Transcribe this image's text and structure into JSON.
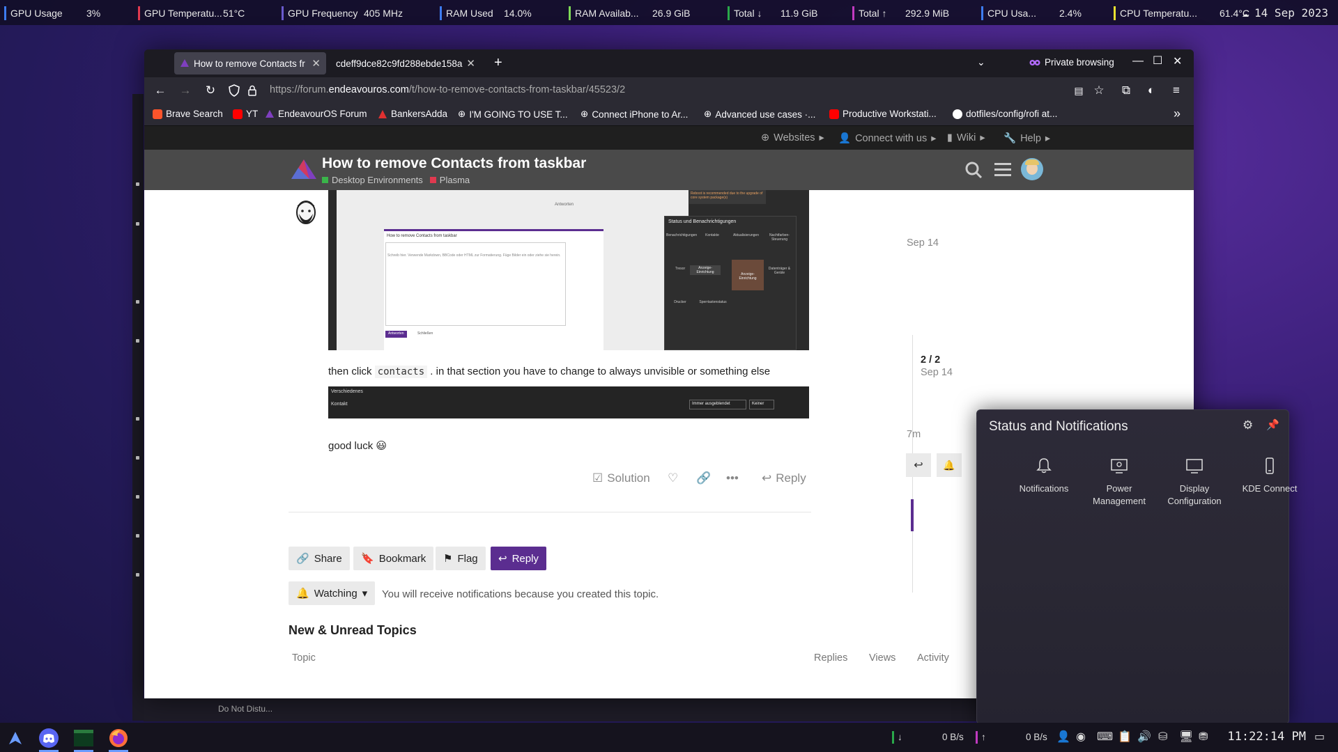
{
  "sysbar": {
    "sensors": [
      {
        "label": "GPU Usage",
        "value": "3%",
        "color": "#3d7cf0"
      },
      {
        "label": "GPU Temperatu...",
        "value": "51°C",
        "color": "#e0394f"
      },
      {
        "label": "GPU Frequency",
        "value": "405 MHz",
        "color": "#6a5acd"
      },
      {
        "label": "RAM Used",
        "value": "14.0%",
        "color": "#3d7cf0"
      },
      {
        "label": "RAM Availab...",
        "value": "26.9 GiB",
        "color": "#7ed957"
      },
      {
        "label": "Total ↓",
        "value": "11.9 GiB",
        "color": "#2aa84a"
      },
      {
        "label": "Total ↑",
        "value": "292.9 MiB",
        "color": "#c03ac0"
      },
      {
        "label": "CPU Usa...",
        "value": "2.4%",
        "color": "#3d7cf0"
      },
      {
        "label": "CPU Temperatu...",
        "value": "61.4°C",
        "color": "#e8e030"
      }
    ],
    "date": "14 Sep 2023"
  },
  "browser": {
    "tabs": [
      {
        "title": "How to remove Contacts fr",
        "active": true
      },
      {
        "title": "cdeff9dce82c9fd288ebde158a",
        "active": false
      }
    ],
    "new_tab": "+",
    "private_label": "Private browsing",
    "url_prefix": "https://forum.",
    "url_domain": "endeavouros.com",
    "url_path": "/t/how-to-remove-contacts-from-taskbar/45523/2",
    "bookmarks": [
      {
        "label": "Brave Search",
        "color": "#fb542b"
      },
      {
        "label": "YT",
        "color": "#ff0000"
      },
      {
        "label": "EndeavourOS Forum",
        "color": "#7f3fbf"
      },
      {
        "label": "BankersAdda",
        "color": "#e03030"
      },
      {
        "label": "I'M GOING TO USE T...",
        "color": "#cccccc"
      },
      {
        "label": "Connect iPhone to Ar...",
        "color": "#cccccc"
      },
      {
        "label": "Advanced use cases ·...",
        "color": "#cccccc"
      },
      {
        "label": "Productive Workstati...",
        "color": "#ff0000"
      },
      {
        "label": "dotfiles/config/rofi at...",
        "color": "#ffffff"
      }
    ],
    "overflow": "»"
  },
  "forum": {
    "topnav": [
      {
        "label": "Websites"
      },
      {
        "label": "Connect with us"
      },
      {
        "label": "Wiki"
      },
      {
        "label": "Help"
      }
    ],
    "title": "How to remove Contacts from taskbar",
    "categories": [
      {
        "label": "Desktop Environments",
        "color": "#3ab54a"
      },
      {
        "label": "Plasma",
        "color": "#e0394f"
      }
    ],
    "post": {
      "line1_before": "then click ",
      "line1_code": "contacts",
      "line1_after": " . in that section you have to change to always unvisible or something else",
      "line2": "good luck 😃",
      "actions": {
        "solution": "Solution",
        "reply": "Reply"
      }
    },
    "buttons": {
      "share": "Share",
      "bookmark": "Bookmark",
      "flag": "Flag",
      "reply": "Reply"
    },
    "watching": "Watching",
    "notify_text": "You will receive notifications because you created this topic.",
    "new_unread": "New & Unread Topics",
    "table_headers": {
      "topic": "Topic",
      "replies": "Replies",
      "views": "Views",
      "activity": "Activity"
    },
    "timeline": {
      "start": "Sep 14",
      "position": "2 / 2",
      "position_date": "Sep 14",
      "end": "7m"
    },
    "screenshot1": {
      "panel_title": "Status und Benachrichtigungen",
      "composer_title": "How to remove Contacts from taskbar",
      "composer_hint": "Schreib hier. Verwende Markdown, BBCode oder HTML zur Formatierung. Füge Bilder ein oder ziehe sie herein.",
      "reply_btn": "Antworten",
      "close_btn": "Schließen",
      "reboot_text": "Reboot is recommended due to the upgrade of core system package(s)",
      "answer_text": "Antworten",
      "items": [
        "Benachrichtigungen",
        "Kontakte",
        "Aktualisierungen",
        "Nachtfarben-Steuerung",
        "Tresor",
        "Anzeige-Einrichtung",
        "Anzeige-Einrichtung",
        "Datenträger & Geräte",
        "Drucker",
        "Sperrtastenstatus"
      ]
    },
    "screenshot2": {
      "section": "Verschiedenes",
      "row_label": "Kontakt",
      "select": "Immer ausgeblendet",
      "shortcut": "Keiner"
    }
  },
  "popup": {
    "title": "Status and Notifications",
    "items": [
      {
        "label": "Notifications"
      },
      {
        "label": "Power Management"
      },
      {
        "label": "Display Configuration"
      },
      {
        "label": "KDE Connect"
      }
    ]
  },
  "taskbar": {
    "do_not_disturb": "Do Not Distu...",
    "net_down": "0 B/s",
    "net_up": "0 B/s",
    "down_arrow": "↓",
    "up_arrow": "↑",
    "clock": "11:22:14 PM"
  }
}
